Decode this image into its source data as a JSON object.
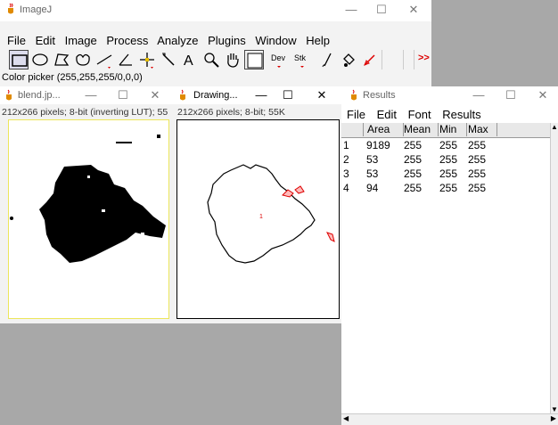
{
  "main": {
    "title": "ImageJ",
    "menu": [
      "File",
      "Edit",
      "Image",
      "Process",
      "Analyze",
      "Plugins",
      "Window",
      "Help"
    ],
    "toolbar": {
      "dev_label": "Dev",
      "stk_label": "Stk",
      "more_label": ">>"
    },
    "status": "Color picker (255,255,255/0,0,0)",
    "controls": {
      "minimize": "—",
      "maximize": "☐",
      "close": "✕"
    }
  },
  "blend": {
    "title": "blend.jp...",
    "info": "212x266 pixels; 8-bit (inverting LUT); 55"
  },
  "drawing": {
    "title": "Drawing...",
    "info": "212x266 pixels; 8-bit; 55K",
    "roi_label": "1"
  },
  "results": {
    "title": "Results",
    "menu": [
      "File",
      "Edit",
      "Font",
      "Results"
    ],
    "columns": [
      "",
      "Area",
      "Mean",
      "Min",
      "Max"
    ],
    "rows": [
      [
        "1",
        "9189",
        "255",
        "255",
        "255"
      ],
      [
        "2",
        "53",
        "255",
        "255",
        "255"
      ],
      [
        "3",
        "53",
        "255",
        "255",
        "255"
      ],
      [
        "4",
        "94",
        "255",
        "255",
        "255"
      ]
    ]
  }
}
